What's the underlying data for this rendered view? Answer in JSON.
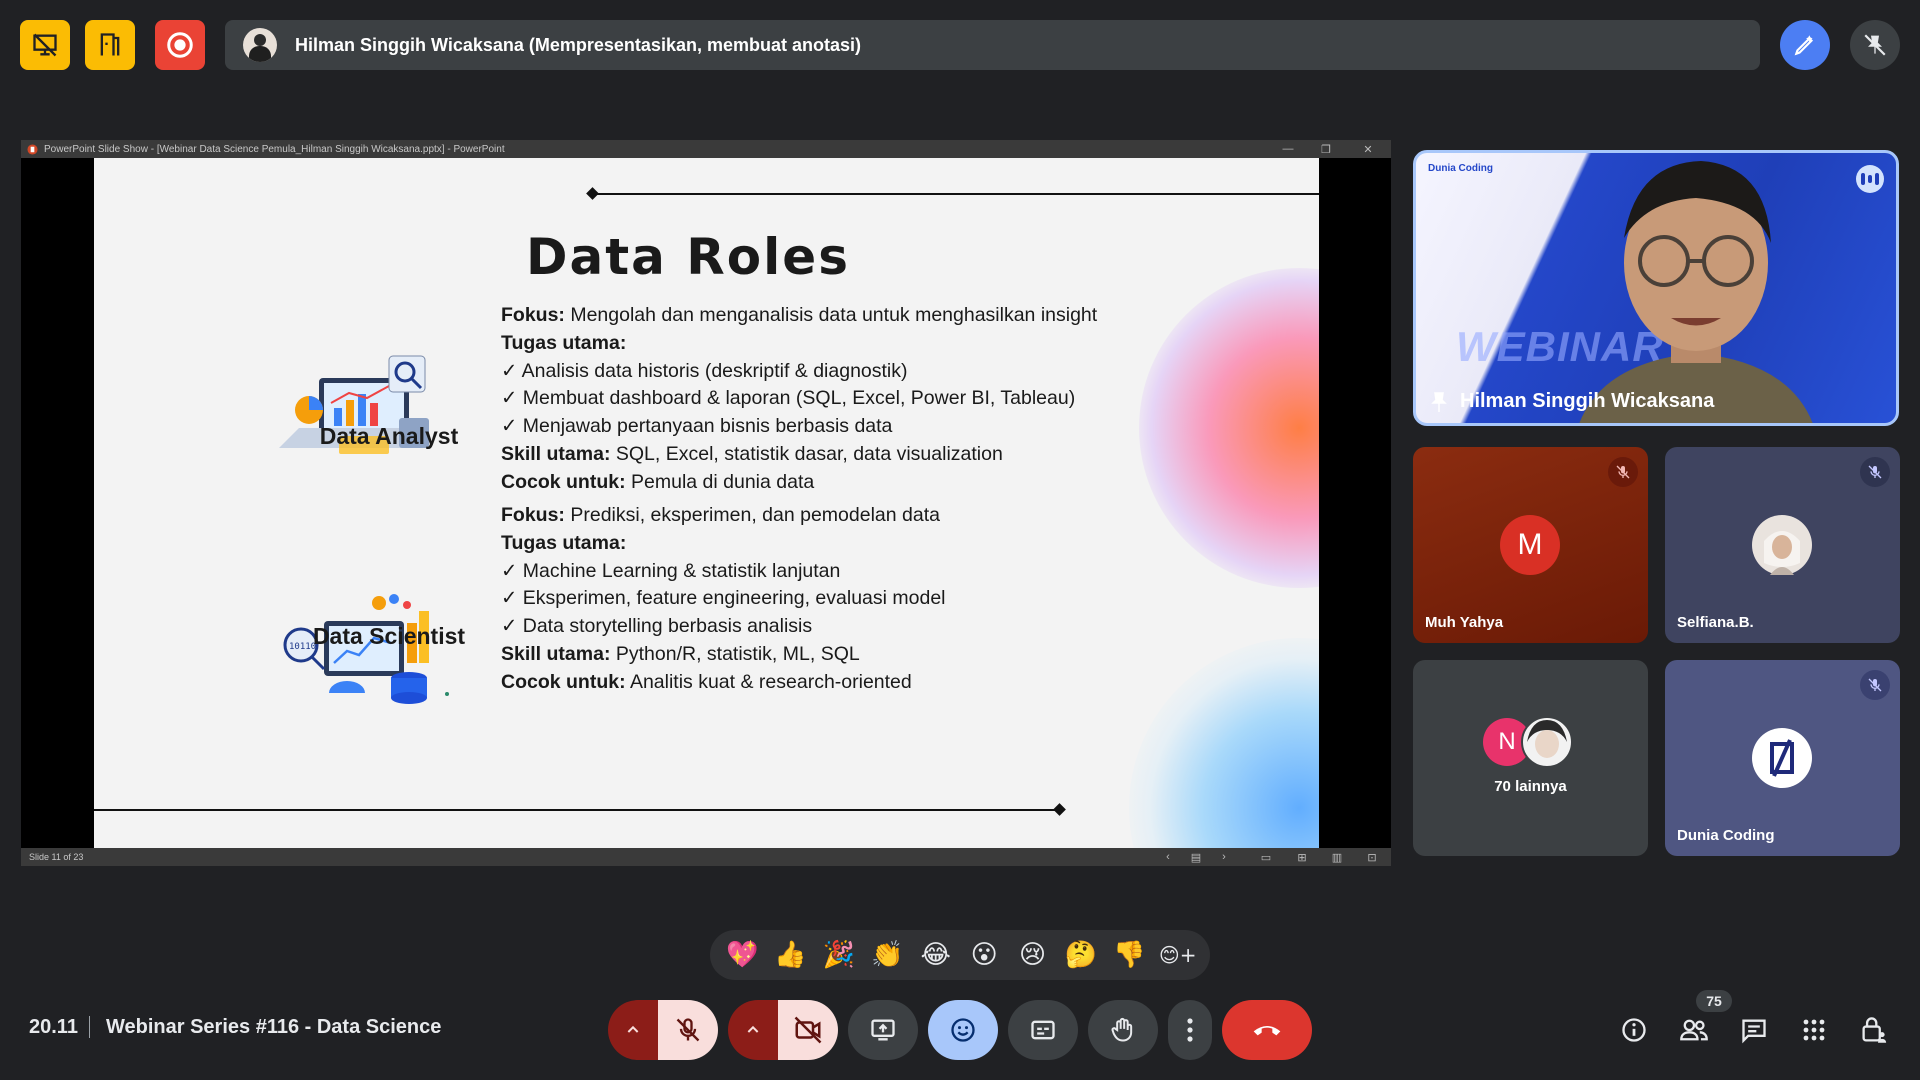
{
  "top_bar": {
    "presenter_text": "Hilman Singgih Wicaksana (Mempresentasikan, membuat anotasi)",
    "icons": [
      "presentation-off-icon",
      "companion-icon",
      "recording-icon",
      "annotate-icon",
      "unpin-icon"
    ]
  },
  "ppt": {
    "window_title": "PowerPoint Slide Show - [Webinar Data Science Pemula_Hilman Singgih Wicaksana.pptx] - PowerPoint",
    "slide_number": "Slide 11 of 23"
  },
  "slide": {
    "title": "Data Roles",
    "roles": [
      {
        "name": "Data Analyst",
        "fokus_label": "Fokus:",
        "fokus": "Mengolah dan menganalisis data untuk menghasilkan insight",
        "tugas_label": "Tugas utama:",
        "tugas": [
          "✓ Analisis data historis (deskriptif & diagnostik)",
          "✓ Membuat dashboard & laporan (SQL, Excel, Power BI, Tableau)",
          "✓ Menjawab pertanyaan bisnis berbasis data"
        ],
        "skill_label": "Skill utama:",
        "skill": "SQL, Excel, statistik dasar, data visualization",
        "cocok_label": "Cocok untuk:",
        "cocok": "Pemula di dunia data"
      },
      {
        "name": "Data Scientist",
        "fokus_label": "Fokus:",
        "fokus": "Prediksi, eksperimen, dan pemodelan data",
        "tugas_label": "Tugas utama:",
        "tugas": [
          "✓ Machine Learning & statistik lanjutan",
          "✓ Eksperimen, feature engineering, evaluasi model",
          "✓ Data storytelling berbasis analisis"
        ],
        "skill_label": "Skill utama:",
        "skill": "Python/R, statistik, ML, SQL",
        "cocok_label": "Cocok untuk:",
        "cocok": "Analitis kuat & research-oriented"
      }
    ]
  },
  "participants": {
    "speaker": {
      "name": "Hilman Singgih Wicaksana",
      "logo_text": "Dunia Coding",
      "bg_text": "WEBINAR"
    },
    "tiles": [
      {
        "name": "Muh Yahya",
        "initial": "M",
        "color": "#b3261e"
      },
      {
        "name": "Selfiana.B."
      },
      {
        "name": "70 lainnya",
        "initial": "N"
      },
      {
        "name": "Dunia Coding"
      }
    ]
  },
  "reactions": [
    "💖",
    "👍",
    "🎉",
    "👏",
    "😂",
    "😮",
    "😢",
    "🤔",
    "👎",
    "😊+"
  ],
  "bottom_bar": {
    "time": "20.11",
    "meeting_title": "Webinar Series #116 - Data Science",
    "participant_count": "75"
  },
  "colors": {
    "background": "#202124",
    "accent_yellow": "#fbbc04",
    "record_red": "#ea4335",
    "end_call_red": "#dc362e",
    "active_blue": "#a8c7fa"
  }
}
